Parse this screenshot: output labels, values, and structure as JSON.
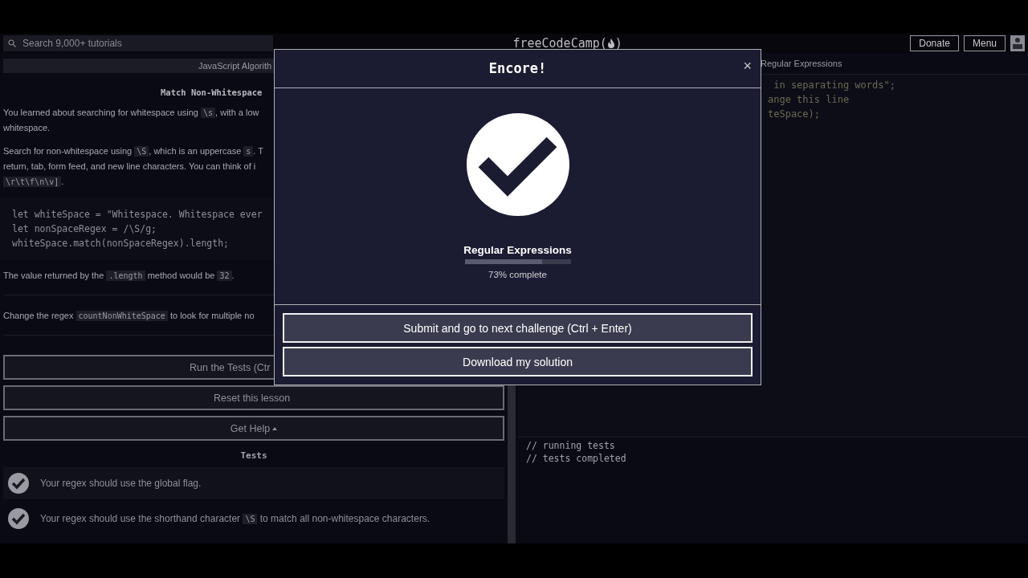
{
  "nav": {
    "search": {
      "placeholder": "Search 9,000+ tutorials"
    },
    "logo": {
      "before": "freeCodeCamp(",
      "after": ")"
    },
    "buttons": [
      "Donate",
      "Menu"
    ]
  },
  "lesson": {
    "breadcrumb": "JavaScript Algorith",
    "title": "Match Non-Whitespace",
    "paragraphs": [
      {
        "lines": [
          [
            {
              "kind": "text",
              "text": "You learned about searching for whitespace using "
            },
            {
              "kind": "code",
              "text": "\\s"
            },
            {
              "kind": "text",
              "text": ", with a low"
            }
          ],
          [
            {
              "kind": "text",
              "text": "whitespace."
            }
          ]
        ]
      },
      {
        "lines": [
          [
            {
              "kind": "text",
              "text": "Search for non-whitespace using "
            },
            {
              "kind": "code",
              "text": "\\S"
            },
            {
              "kind": "text",
              "text": ", which is an uppercase "
            },
            {
              "kind": "code",
              "text": "s"
            },
            {
              "kind": "text",
              "text": ". T"
            }
          ],
          [
            {
              "kind": "text",
              "text": "return, tab, form feed, and new line characters. You can think of i"
            }
          ],
          [
            {
              "kind": "code",
              "text": "\\r\\t\\f\\n\\v]"
            },
            {
              "kind": "text",
              "text": "."
            }
          ]
        ]
      }
    ],
    "code": [
      "let whiteSpace = \"Whitespace. Whitespace ever",
      "let nonSpaceRegex = /\\S/g;",
      "whiteSpace.match(nonSpaceRegex).length;"
    ],
    "result": [
      {
        "kind": "text",
        "text": "The value returned by the "
      },
      {
        "kind": "code",
        "text": ".length"
      },
      {
        "kind": "text",
        "text": " method would be "
      },
      {
        "kind": "code",
        "text": "32"
      },
      {
        "kind": "text",
        "text": "."
      }
    ],
    "task": [
      {
        "kind": "text",
        "text": "Change the regex "
      },
      {
        "kind": "code",
        "text": "countNonWhiteSpace"
      },
      {
        "kind": "text",
        "text": " to look for multiple no"
      }
    ],
    "buttons": [
      "Run the Tests (Ctr",
      "Reset this lesson"
    ],
    "help_button": "Get Help",
    "tests_heading": "Tests",
    "tests": [
      {
        "passed": true,
        "text": [
          {
            "kind": "text",
            "text": "Your regex should use the global flag."
          }
        ]
      },
      {
        "passed": true,
        "text": [
          {
            "kind": "text",
            "text": "Your regex should use the shorthand character "
          },
          {
            "kind": "code",
            "text": "\\S"
          },
          {
            "kind": "text",
            "text": " to match all non-whitespace characters."
          }
        ]
      }
    ]
  },
  "editor": {
    "breadcrumb": "Regular Expressions",
    "lines": [
      " in separating words\";",
      "ange this line",
      "teSpace);"
    ]
  },
  "console": [
    "// running tests",
    "// tests completed"
  ],
  "modal": {
    "title": "Encore!",
    "close": "×",
    "block": "Regular Expressions",
    "level": 0.73,
    "progress_text": "73% complete",
    "buttons": [
      "Submit and go to next challenge (Ctrl + Enter)",
      "Download my solution"
    ]
  }
}
